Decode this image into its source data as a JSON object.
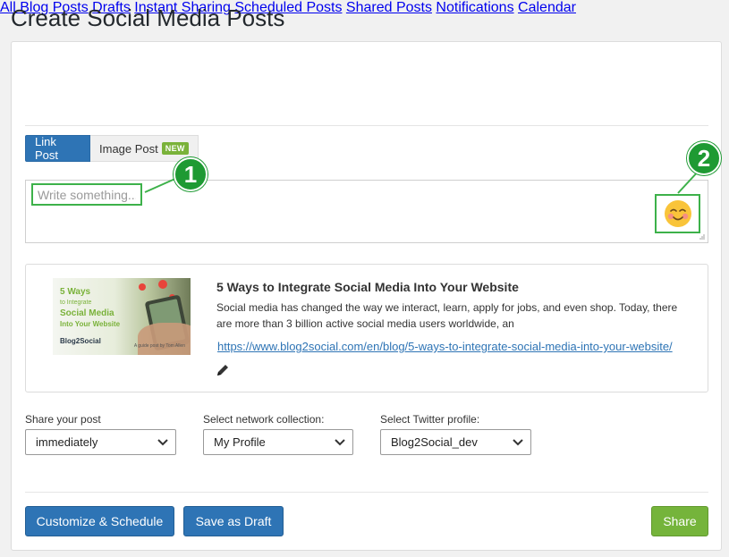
{
  "page": {
    "title": "Create Social Media Posts"
  },
  "nav": {
    "items": [
      {
        "label": "All Blog Posts"
      },
      {
        "label": "Drafts"
      },
      {
        "label": "Instant Sharing"
      },
      {
        "label": "Scheduled Posts"
      },
      {
        "label": "Shared Posts"
      },
      {
        "label": "Notifications"
      },
      {
        "label": "Calendar"
      }
    ]
  },
  "tabs": {
    "link": "Link Post",
    "image": "Image Post",
    "image_badge": "NEW"
  },
  "composer": {
    "placeholder": "Write something...",
    "emoji_icon": "smiling-face-icon"
  },
  "callouts": {
    "first": "1",
    "second": "2"
  },
  "preview": {
    "thumb_title_lines": [
      "5 Ways",
      "to Integrate",
      "Social Media",
      "Into Your Website"
    ],
    "thumb_brand": "Blog2Social",
    "thumb_caption": "A guide post by Tom Allen",
    "title": "5 Ways to Integrate Social Media Into Your Website",
    "description": "Social media has changed the way we interact, learn, apply for jobs, and even shop. Today, there are more than 3 billion active social media users worldwide, an",
    "url": "https://www.blog2social.com/en/blog/5-ways-to-integrate-social-media-into-your-website/"
  },
  "fields": {
    "share": {
      "label": "Share your post",
      "value": "immediately"
    },
    "network": {
      "label": "Select network collection:",
      "value": "My Profile"
    },
    "twitter": {
      "label": "Select Twitter profile:",
      "value": "Blog2Social_dev"
    }
  },
  "buttons": {
    "customize": "Customize & Schedule",
    "draft": "Save as Draft",
    "share": "Share"
  },
  "colors": {
    "accent": "#2e74b5",
    "success": "#75b43b",
    "callout": "#1e9a33",
    "highlight": "#3db14a"
  }
}
